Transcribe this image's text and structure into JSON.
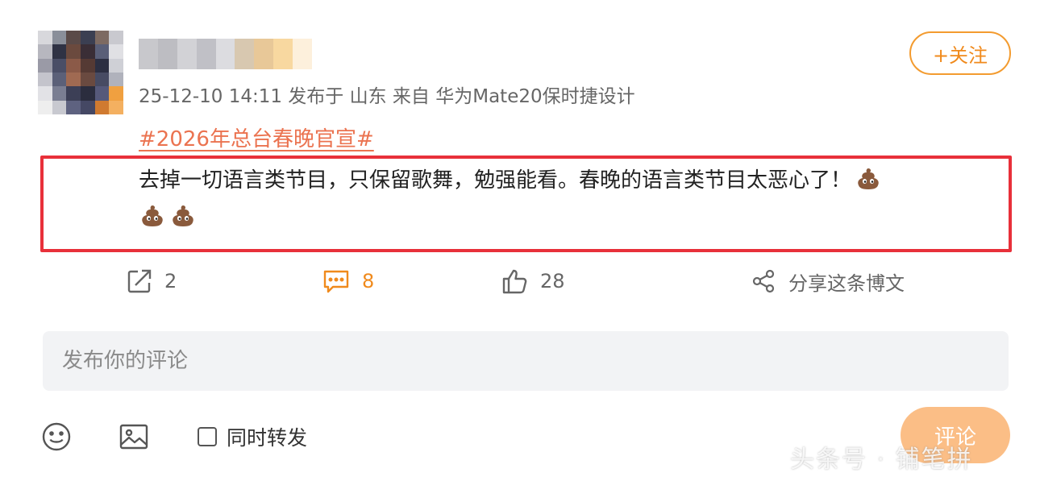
{
  "post": {
    "follow_label": "+关注",
    "meta_line": "25-12-10 14:11  发布于 山东  来自 华为Mate20保时捷设计",
    "hashtag": "#2026年总台春晚官宣#",
    "text": "去掉一切语言类节目，只保留歌舞，勉强能看。春晚的语言类节目太恶心了！",
    "emoji_icon": "poo-emoji"
  },
  "actions": {
    "repost_count": "2",
    "comment_count": "8",
    "like_count": "28",
    "share_label": "分享这条博文"
  },
  "comment_box": {
    "placeholder": "发布你的评论",
    "forward_label": "同时转发",
    "submit_label": "评论"
  },
  "watermark": "头条号 · 铺笔拼",
  "colors": {
    "accent": "#f08a1c",
    "hashtag": "#eb7350",
    "highlight_border": "#e8303a",
    "submit_bg": "#fbbe86"
  }
}
